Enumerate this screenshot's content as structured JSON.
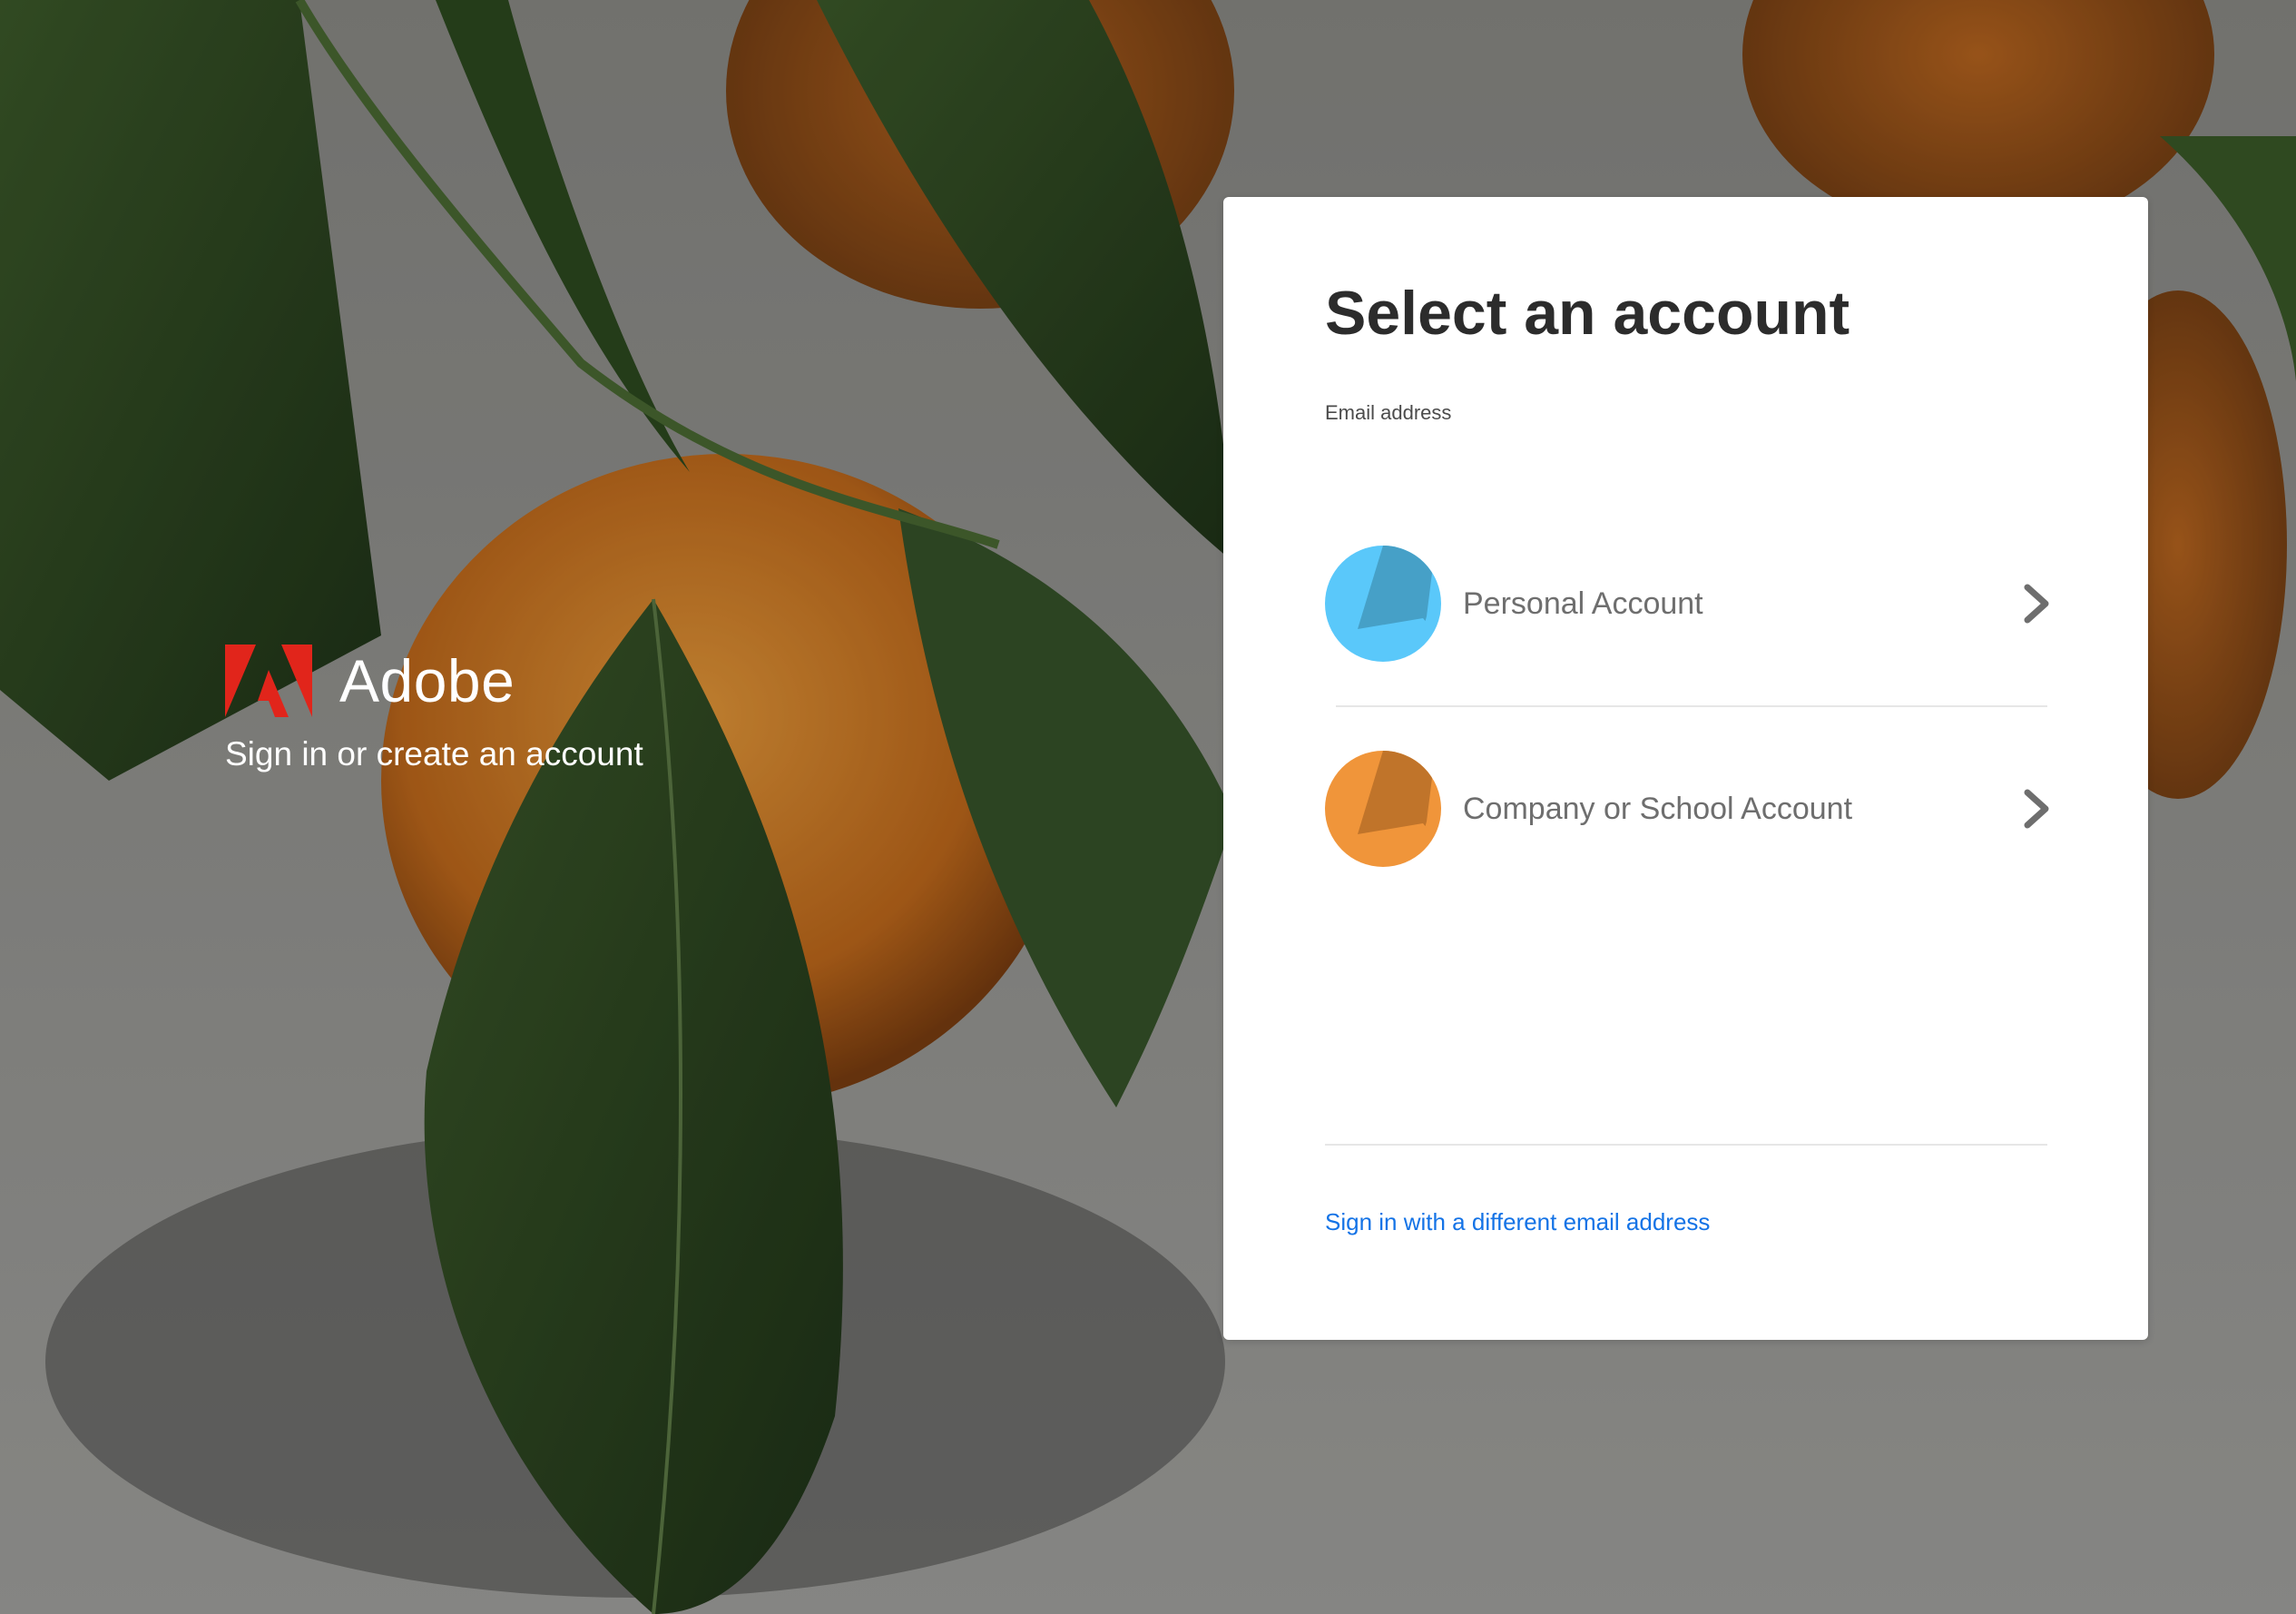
{
  "brand": {
    "name": "Adobe",
    "tagline": "Sign in or create an account",
    "logo_icon": "adobe-logo-icon",
    "logo_color": "#e1251b"
  },
  "card": {
    "title": "Select an account",
    "email_label": "Email address",
    "accounts": [
      {
        "label": "Personal Account",
        "icon": "personal-account-avatar-icon",
        "color": "#5ac8fa",
        "accent_color": "#46a0c7"
      },
      {
        "label": "Company or School Account",
        "icon": "company-account-avatar-icon",
        "color": "#f0953a",
        "accent_color": "#c0742a"
      }
    ],
    "chevron_icon": "chevron-right-icon",
    "alt_link": "Sign in with a different email address",
    "link_color": "#1473e6"
  }
}
